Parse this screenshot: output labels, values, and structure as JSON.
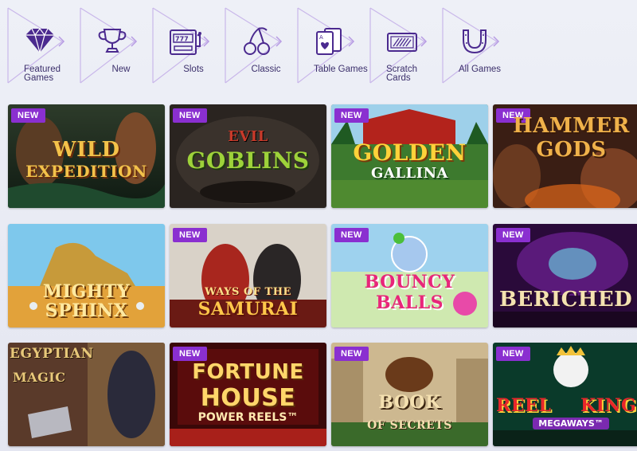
{
  "categories": [
    {
      "label": "Featured Games",
      "icon": "diamond-icon"
    },
    {
      "label": "New",
      "icon": "trophy-icon"
    },
    {
      "label": "Slots",
      "icon": "slot-machine-icon"
    },
    {
      "label": "Classic",
      "icon": "cherries-icon"
    },
    {
      "label": "Table Games",
      "icon": "playing-cards-icon"
    },
    {
      "label": "Scratch Cards",
      "icon": "scratch-card-icon"
    },
    {
      "label": "All Games",
      "icon": "horseshoe-icon"
    }
  ],
  "badge_label": "NEW",
  "accent_color": "#8a2fd0",
  "nav_color": "#4b2a8f",
  "games": [
    {
      "title_line1": "WILD",
      "title_line2": "EXPEDITION",
      "badge": true
    },
    {
      "title_line1": "EVIL",
      "title_line2": "GOBLINS",
      "badge": true
    },
    {
      "title_line1": "GOLDEN",
      "title_line2": "GALLINA",
      "badge": true
    },
    {
      "title_line1": "HAMMER",
      "title_line2": "GODS",
      "badge": true
    },
    {
      "title_line1": "MIGHTY",
      "title_line2": "SPHINX",
      "badge": false
    },
    {
      "title_line1": "WAYS OF THE",
      "title_line2": "SAMURAI",
      "badge": true
    },
    {
      "title_line1": "BOUNCY",
      "title_line2": "BALLS",
      "badge": true
    },
    {
      "title_line1": "BERICHED",
      "title_line2": "",
      "badge": true
    },
    {
      "title_line1": "EGYPTIAN",
      "title_line2": "MAGIC",
      "badge": false
    },
    {
      "title_line1": "FORTUNE",
      "title_line2": "HOUSE",
      "sub": "POWER REELS™",
      "badge": true
    },
    {
      "title_line1": "BOOK",
      "title_line2": "OF SECRETS",
      "badge": true
    },
    {
      "title_line1": "REEL",
      "title_line2": "KING",
      "sub": "MEGAWAYS™",
      "badge": true
    }
  ]
}
